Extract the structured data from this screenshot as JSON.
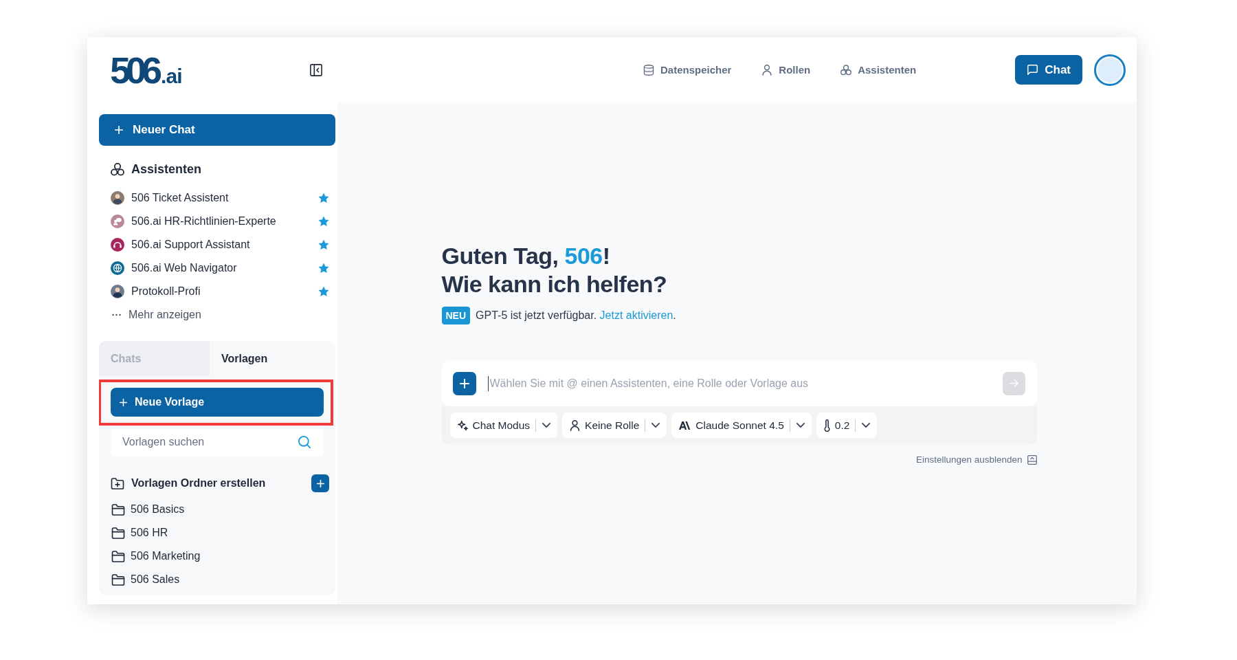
{
  "header": {
    "logo": {
      "mark": "506",
      "suffix": ".ai"
    },
    "nav": [
      {
        "label": "Datenspeicher"
      },
      {
        "label": "Rollen"
      },
      {
        "label": "Assistenten"
      }
    ],
    "chat_button": {
      "label": "Chat"
    }
  },
  "sidebar": {
    "new_chat_button": {
      "label": "Neuer Chat"
    },
    "assistants": {
      "title": "Assistenten",
      "items": [
        {
          "name": "506 Ticket Assistent",
          "color": "#8c7b70",
          "starred": true
        },
        {
          "name": "506.ai HR-Richtlinien-Experte",
          "color": "#b98a96",
          "starred": true
        },
        {
          "name": "506.ai Support Assistant",
          "color": "#a8265e",
          "starred": true
        },
        {
          "name": "506.ai Web Navigator",
          "color": "#0f6b96",
          "starred": true
        },
        {
          "name": "Protokoll-Profi",
          "color": "#6d7b8c",
          "starred": true
        }
      ],
      "more": "Mehr anzeigen"
    },
    "tabs": [
      {
        "label": "Chats",
        "selected": false
      },
      {
        "label": "Vorlagen",
        "selected": true
      }
    ],
    "templates": {
      "new_button": {
        "label": "Neue Vorlage",
        "highlighted": true
      },
      "search": {
        "placeholder": "Vorlagen suchen"
      },
      "create_folder": {
        "label": "Vorlagen Ordner erstellen"
      },
      "folders": [
        {
          "name": "506 Basics"
        },
        {
          "name": "506 HR"
        },
        {
          "name": "506 Marketing"
        },
        {
          "name": "506 Sales"
        }
      ]
    }
  },
  "main": {
    "greeting": {
      "before": "Guten Tag,",
      "name": "506",
      "after": "!",
      "question": "Wie kann ich helfen?"
    },
    "announcement": {
      "badge": "NEU",
      "text": "GPT-5 ist jetzt verfügbar.",
      "link": "Jetzt aktivieren",
      "after": "."
    },
    "composer": {
      "placeholder": "Wählen Sie mit @ einen Assistenten, eine Rolle oder Vorlage aus",
      "send_button": {
        "disabled": true
      },
      "settings": [
        {
          "kind": "mode",
          "label": "Chat Modus"
        },
        {
          "kind": "role",
          "label": "Keine Rolle"
        },
        {
          "kind": "model",
          "label": "Claude Sonnet 4.5"
        },
        {
          "kind": "temperature",
          "label": "0.2"
        }
      ]
    },
    "hide_settings": "Einstellungen ausblenden"
  }
}
